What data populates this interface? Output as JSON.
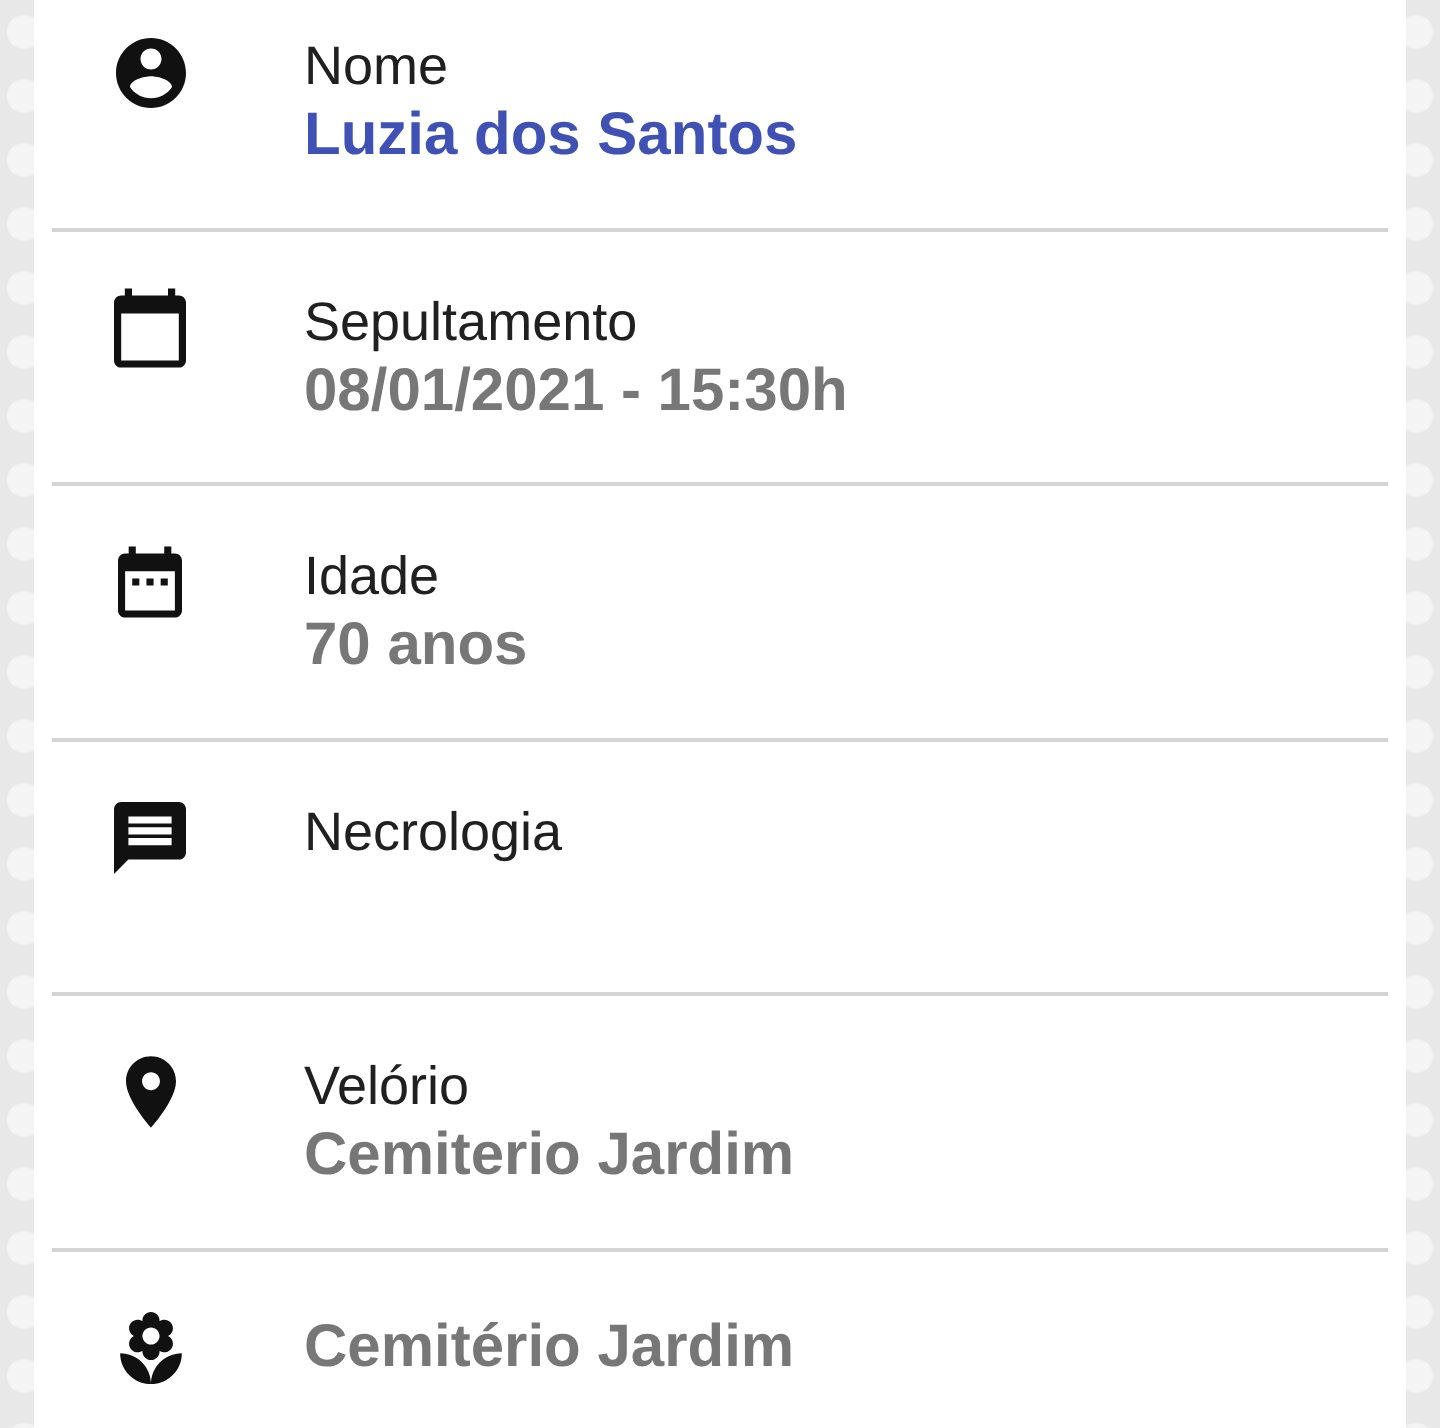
{
  "rows": [
    {
      "kind": "name",
      "label": "Nome",
      "value": "Luzia dos Santos"
    },
    {
      "kind": "detail",
      "label": "Sepultamento",
      "value": "08/01/2021 - 15:30h"
    },
    {
      "kind": "detail",
      "label": "Idade",
      "value": "70 anos"
    },
    {
      "kind": "detail",
      "label": "Necrologia"
    },
    {
      "kind": "detail",
      "label": "Velório",
      "value": "Cemiterio Jardim"
    },
    {
      "kind": "detail",
      "value": "Cemitério Jardim"
    }
  ]
}
